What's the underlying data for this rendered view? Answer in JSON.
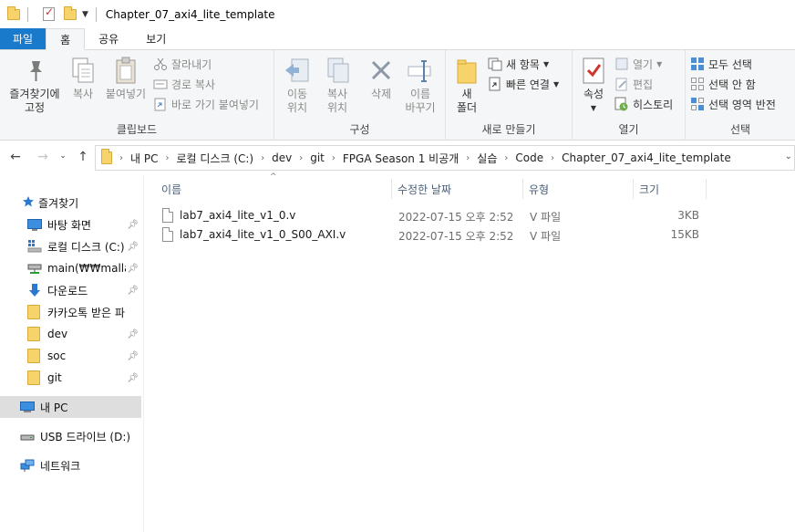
{
  "window": {
    "title": "Chapter_07_axi4_lite_template"
  },
  "tabs": [
    "파일",
    "홈",
    "공유",
    "보기"
  ],
  "ribbon": {
    "clipboard": {
      "pin_line1": "즐겨찾기에",
      "pin_line2": "고정",
      "copy": "복사",
      "paste": "붙여넣기",
      "cut": "잘라내기",
      "copy_path": "경로 복사",
      "paste_shortcut": "바로 가기 붙여넣기",
      "label": "클립보드"
    },
    "organize": {
      "move_line1": "이동",
      "move_line2": "위치",
      "copyto_line1": "복사",
      "copyto_line2": "위치",
      "delete": "삭제",
      "rename_line1": "이름",
      "rename_line2": "바꾸기",
      "label": "구성"
    },
    "new": {
      "newfolder_line1": "새",
      "newfolder_line2": "폴더",
      "new_item": "새 항목",
      "easy_access": "빠른 연결",
      "label": "새로 만들기"
    },
    "open": {
      "properties": "속성",
      "open": "열기",
      "edit": "편집",
      "history": "히스토리",
      "label": "열기"
    },
    "select": {
      "select_all": "모두 선택",
      "select_none": "선택 안 함",
      "invert": "선택 영역 반전",
      "label": "선택"
    }
  },
  "breadcrumb": [
    "내 PC",
    "로컬 디스크 (C:)",
    "dev",
    "git",
    "FPGA Season 1 비공개",
    "실습",
    "Code",
    "Chapter_07_axi4_lite_template"
  ],
  "sidebar": {
    "quick_access": "즐겨찾기",
    "items": [
      {
        "label": "바탕 화면",
        "icon": "desktop-icon"
      },
      {
        "label": "로컬 디스크 (C:)",
        "icon": "drive-icon"
      },
      {
        "label": "main(₩₩mallaer",
        "icon": "network-drive-icon"
      },
      {
        "label": "다운로드",
        "icon": "download-icon"
      },
      {
        "label": "카카오톡 받은 파",
        "icon": "folder-icon"
      },
      {
        "label": "dev",
        "icon": "folder-icon"
      },
      {
        "label": "soc",
        "icon": "folder-icon"
      },
      {
        "label": "git",
        "icon": "folder-icon"
      }
    ],
    "this_pc": "내 PC",
    "usb": "USB 드라이브 (D:)",
    "network": "네트워크"
  },
  "columns": {
    "name": "이름",
    "modified": "수정한 날짜",
    "type": "유형",
    "size": "크기"
  },
  "files": [
    {
      "name": "lab7_axi4_lite_v1_0.v",
      "modified": "2022-07-15 오후 2:52",
      "type": "V 파일",
      "size": "3KB"
    },
    {
      "name": "lab7_axi4_lite_v1_0_S00_AXI.v",
      "modified": "2022-07-15 오후 2:52",
      "type": "V 파일",
      "size": "15KB"
    }
  ],
  "colors": {
    "accent": "#1979ca",
    "folder": "#f7d36b",
    "selected": "#dedede"
  }
}
